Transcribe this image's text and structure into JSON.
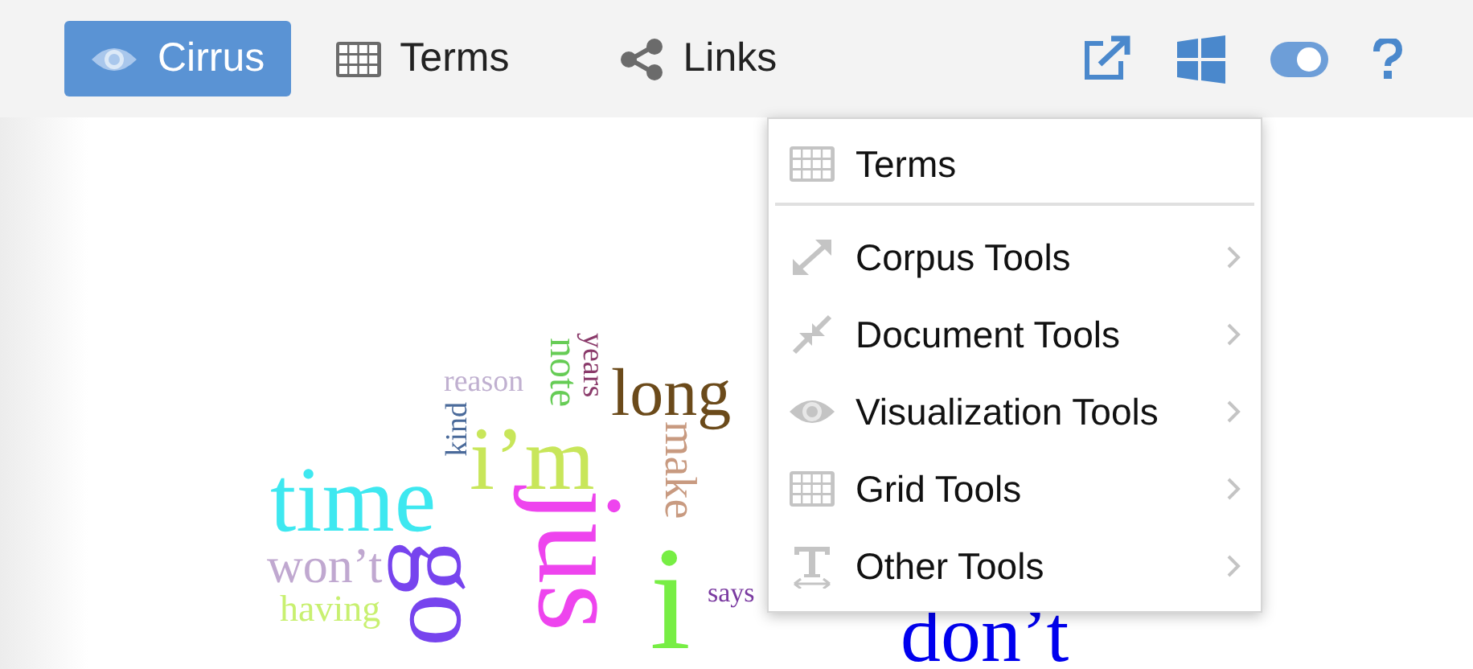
{
  "tabs": [
    {
      "label": "Cirrus",
      "selected": true
    },
    {
      "label": "Terms",
      "selected": false
    },
    {
      "label": "Links",
      "selected": false
    }
  ],
  "menu": [
    {
      "label": "Terms",
      "has_submenu": false
    },
    {
      "label": "Corpus Tools",
      "has_submenu": true
    },
    {
      "label": "Document Tools",
      "has_submenu": true
    },
    {
      "label": "Visualization Tools",
      "has_submenu": true
    },
    {
      "label": "Grid Tools",
      "has_submenu": true
    },
    {
      "label": "Other Tools",
      "has_submenu": true
    }
  ],
  "cloud_words": [
    {
      "text": "reason",
      "color": "#c0b0d0",
      "kind": "flat"
    },
    {
      "text": "kind",
      "color": "#4a6a9a",
      "kind": "up"
    },
    {
      "text": "note",
      "color": "#66cc55",
      "kind": "down"
    },
    {
      "text": "years",
      "color": "#8a3a6a",
      "kind": "down"
    },
    {
      "text": "long",
      "color": "#6b4a1a",
      "kind": "flat"
    },
    {
      "text": "i’m",
      "color": "#c8e65a",
      "kind": "flat"
    },
    {
      "text": "make",
      "color": "#c89a80",
      "kind": "down"
    },
    {
      "text": "time",
      "color": "#3ee8f0",
      "kind": "flat"
    },
    {
      "text": "won’t",
      "color": "#c0a8d0",
      "kind": "flat"
    },
    {
      "text": "having",
      "color": "#c8f070",
      "kind": "flat"
    },
    {
      "text": "i",
      "color": "#77ee44",
      "kind": "flat"
    },
    {
      "text": "says",
      "color": "#7a3aa0",
      "kind": "flat"
    },
    {
      "text": "jus",
      "color": "#ee44ee",
      "kind": "down"
    },
    {
      "text": "go",
      "color": "#7744ee",
      "kind": "down"
    },
    {
      "text": "don’t",
      "color": "#0000ee",
      "kind": "flat"
    }
  ]
}
